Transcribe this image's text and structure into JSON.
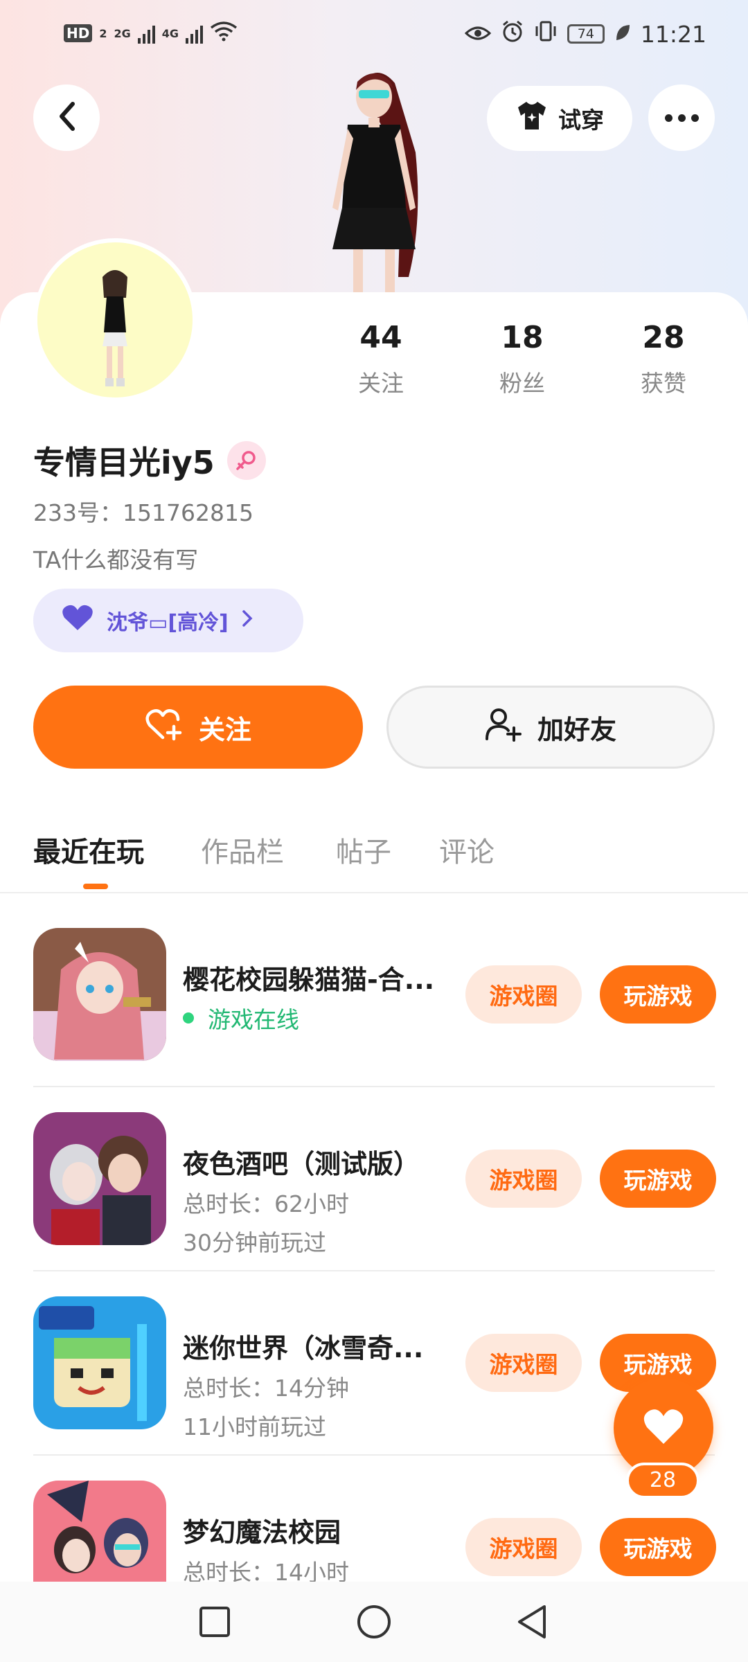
{
  "status_bar": {
    "left_badges": [
      "HD",
      "2",
      "2G",
      "4G"
    ],
    "battery": "74",
    "time": "11:21"
  },
  "header": {
    "try_on_label": "试穿"
  },
  "profile": {
    "stats": [
      {
        "value": "44",
        "label": "关注"
      },
      {
        "value": "18",
        "label": "粉丝"
      },
      {
        "value": "28",
        "label": "获赞"
      }
    ],
    "username": "专情目光iy5",
    "uid": "233号：151762815",
    "bio": "TA什么都没有写",
    "relation_label": "沈爷▭[高冷]"
  },
  "actions": {
    "follow_label": "关注",
    "add_friend_label": "加好友"
  },
  "tabs": [
    "最近在玩",
    "作品栏",
    "帖子",
    "评论"
  ],
  "games": [
    {
      "title": "樱花校园躲猫猫-合...",
      "meta1": "游戏在线",
      "meta2": "",
      "online": true,
      "circle_label": "游戏圈",
      "play_label": "玩游戏",
      "icon": "anime-girl-gun-icon"
    },
    {
      "title": "夜色酒吧（测试版）",
      "meta1": "总时长：62小时",
      "meta2": "30分钟前玩过",
      "online": false,
      "circle_label": "游戏圈",
      "play_label": "玩游戏",
      "icon": "bar-couple-icon"
    },
    {
      "title": "迷你世界（冰雪奇...",
      "meta1": "总时长：14分钟",
      "meta2": "11小时前玩过",
      "online": false,
      "circle_label": "游戏圈",
      "play_label": "玩游戏",
      "icon": "mini-world-icon"
    },
    {
      "title": "梦幻魔法校园",
      "meta1": "总时长：14小时",
      "meta2": "",
      "online": false,
      "circle_label": "游戏圈",
      "play_label": "玩游戏",
      "icon": "magic-school-icon"
    }
  ],
  "like_fab": {
    "count": "28"
  },
  "colors": {
    "accent": "#ff7212",
    "online": "#22b873",
    "relation": "#6254d8"
  }
}
